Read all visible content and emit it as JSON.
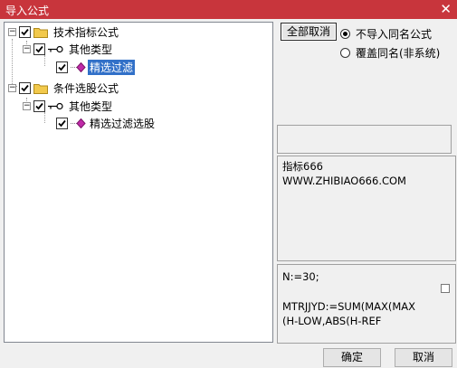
{
  "window": {
    "title": "导入公式",
    "close_glyph": "✕"
  },
  "tree": {
    "nodes": [
      {
        "label": "技术指标公式",
        "expander": "−",
        "checked": true,
        "icon": "folder-icon"
      },
      {
        "label": "其他类型",
        "expander": "−",
        "checked": true,
        "icon": "key-icon"
      },
      {
        "label": "精选过滤",
        "checked": true,
        "icon": "formula-gem-icon",
        "selected": true
      },
      {
        "label": "条件选股公式",
        "expander": "−",
        "checked": true,
        "icon": "folder-icon"
      },
      {
        "label": "其他类型",
        "expander": "−",
        "checked": true,
        "icon": "key-icon"
      },
      {
        "label": "精选过滤选股",
        "checked": true,
        "icon": "formula-gem-icon"
      }
    ]
  },
  "options": {
    "deselect_all_label": "全部取消",
    "radio_no_import_label": "不导入同名公式",
    "radio_overwrite_label": "覆盖同名(非系统)",
    "selected": "no_import"
  },
  "info": {
    "line1": "指标666",
    "line2": "WWW.ZHIBIAO666.COM"
  },
  "formula": {
    "line1": "N:=30;",
    "line2": "",
    "line3": "MTRJJYD:=SUM(MAX(MAX",
    "line4": "(H-LOW,ABS(H-REF"
  },
  "footer": {
    "ok_label": "确定",
    "cancel_label": "取消"
  },
  "colors": {
    "titlebar": "#c8353c",
    "selection": "#3170c8",
    "gem": "#c02aa8",
    "folder": "#f2c94c"
  }
}
